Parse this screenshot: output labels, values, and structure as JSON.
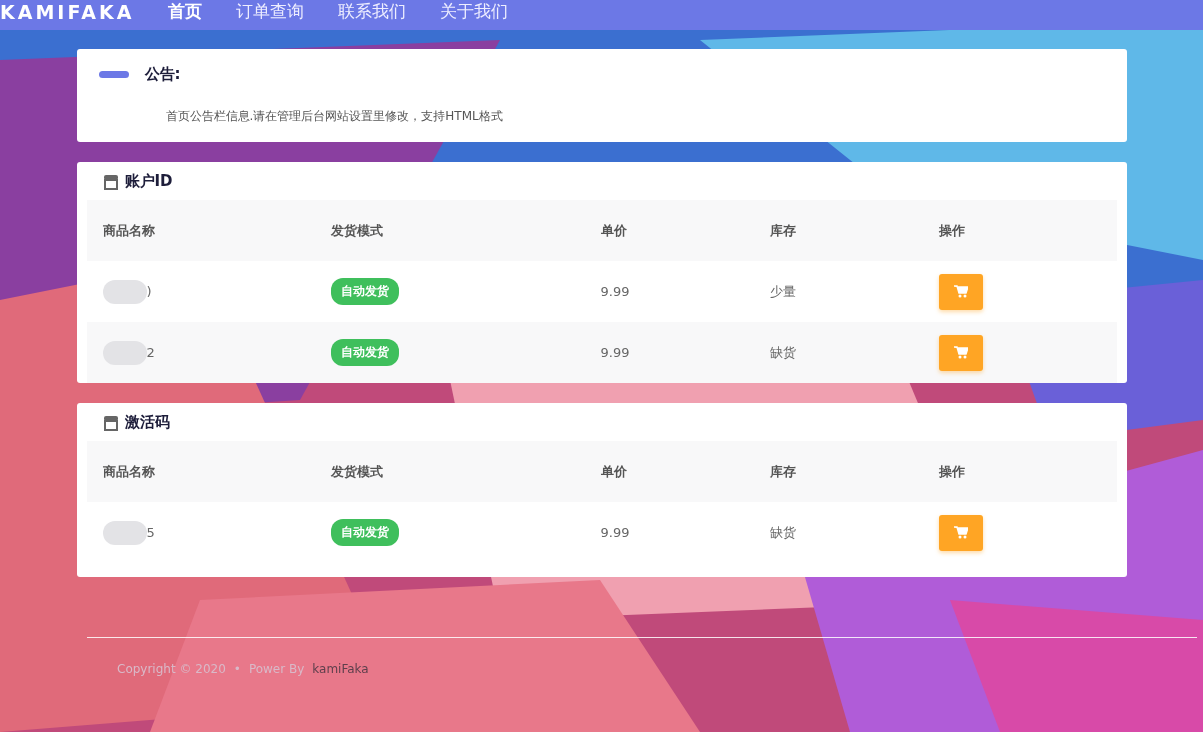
{
  "nav": {
    "brand": "KAMIFAKA",
    "items": [
      {
        "label": "首页",
        "selected": true
      },
      {
        "label": "订单查询",
        "selected": false
      },
      {
        "label": "联系我们",
        "selected": false
      },
      {
        "label": "关于我们",
        "selected": false
      }
    ]
  },
  "notice": {
    "title": "公告:",
    "text": "首页公告栏信息.请在管理后台网站设置里修改，支持HTML格式"
  },
  "sections": [
    {
      "title": "账户ID",
      "columns": [
        "商品名称",
        "发货模式",
        "单价",
        "库存",
        "操作"
      ],
      "rows": [
        {
          "name_tail": ")",
          "delivery": "自动发货",
          "price": "9.99",
          "stock": "少量"
        },
        {
          "name_tail": "2",
          "delivery": "自动发货",
          "price": "9.99",
          "stock": "缺货"
        }
      ]
    },
    {
      "title": "激活码",
      "columns": [
        "商品名称",
        "发货模式",
        "单价",
        "库存",
        "操作"
      ],
      "rows": [
        {
          "name_tail": "5",
          "delivery": "自动发货",
          "price": "9.99",
          "stock": "缺货"
        }
      ]
    }
  ],
  "footer": {
    "copyright": "Copyright © 2020",
    "separator": "•",
    "power": "Power By",
    "link": "kamiFaka"
  }
}
